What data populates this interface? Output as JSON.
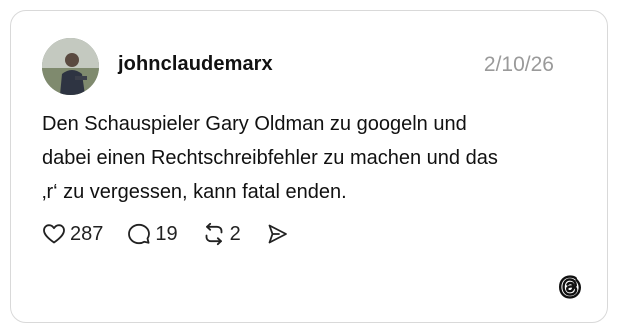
{
  "post": {
    "username": "johnclaudemarx",
    "date": "2/10/26",
    "text_lines": [
      "Den Schauspieler Gary Oldman zu googeln und",
      "dabei einen Rechtschreibfehler zu machen und das",
      "‚r‘ zu vergessen, kann fatal enden."
    ]
  },
  "actions": {
    "likes": "287",
    "replies": "19",
    "reposts": "2"
  },
  "icons": {
    "like": "heart-icon",
    "reply": "speech-bubble-icon",
    "repost": "repost-arrows-icon",
    "share": "send-icon",
    "logo": "threads-logo-icon"
  },
  "colors": {
    "border": "#d9d9d9",
    "date": "#9a9a9a",
    "text": "#111111"
  }
}
